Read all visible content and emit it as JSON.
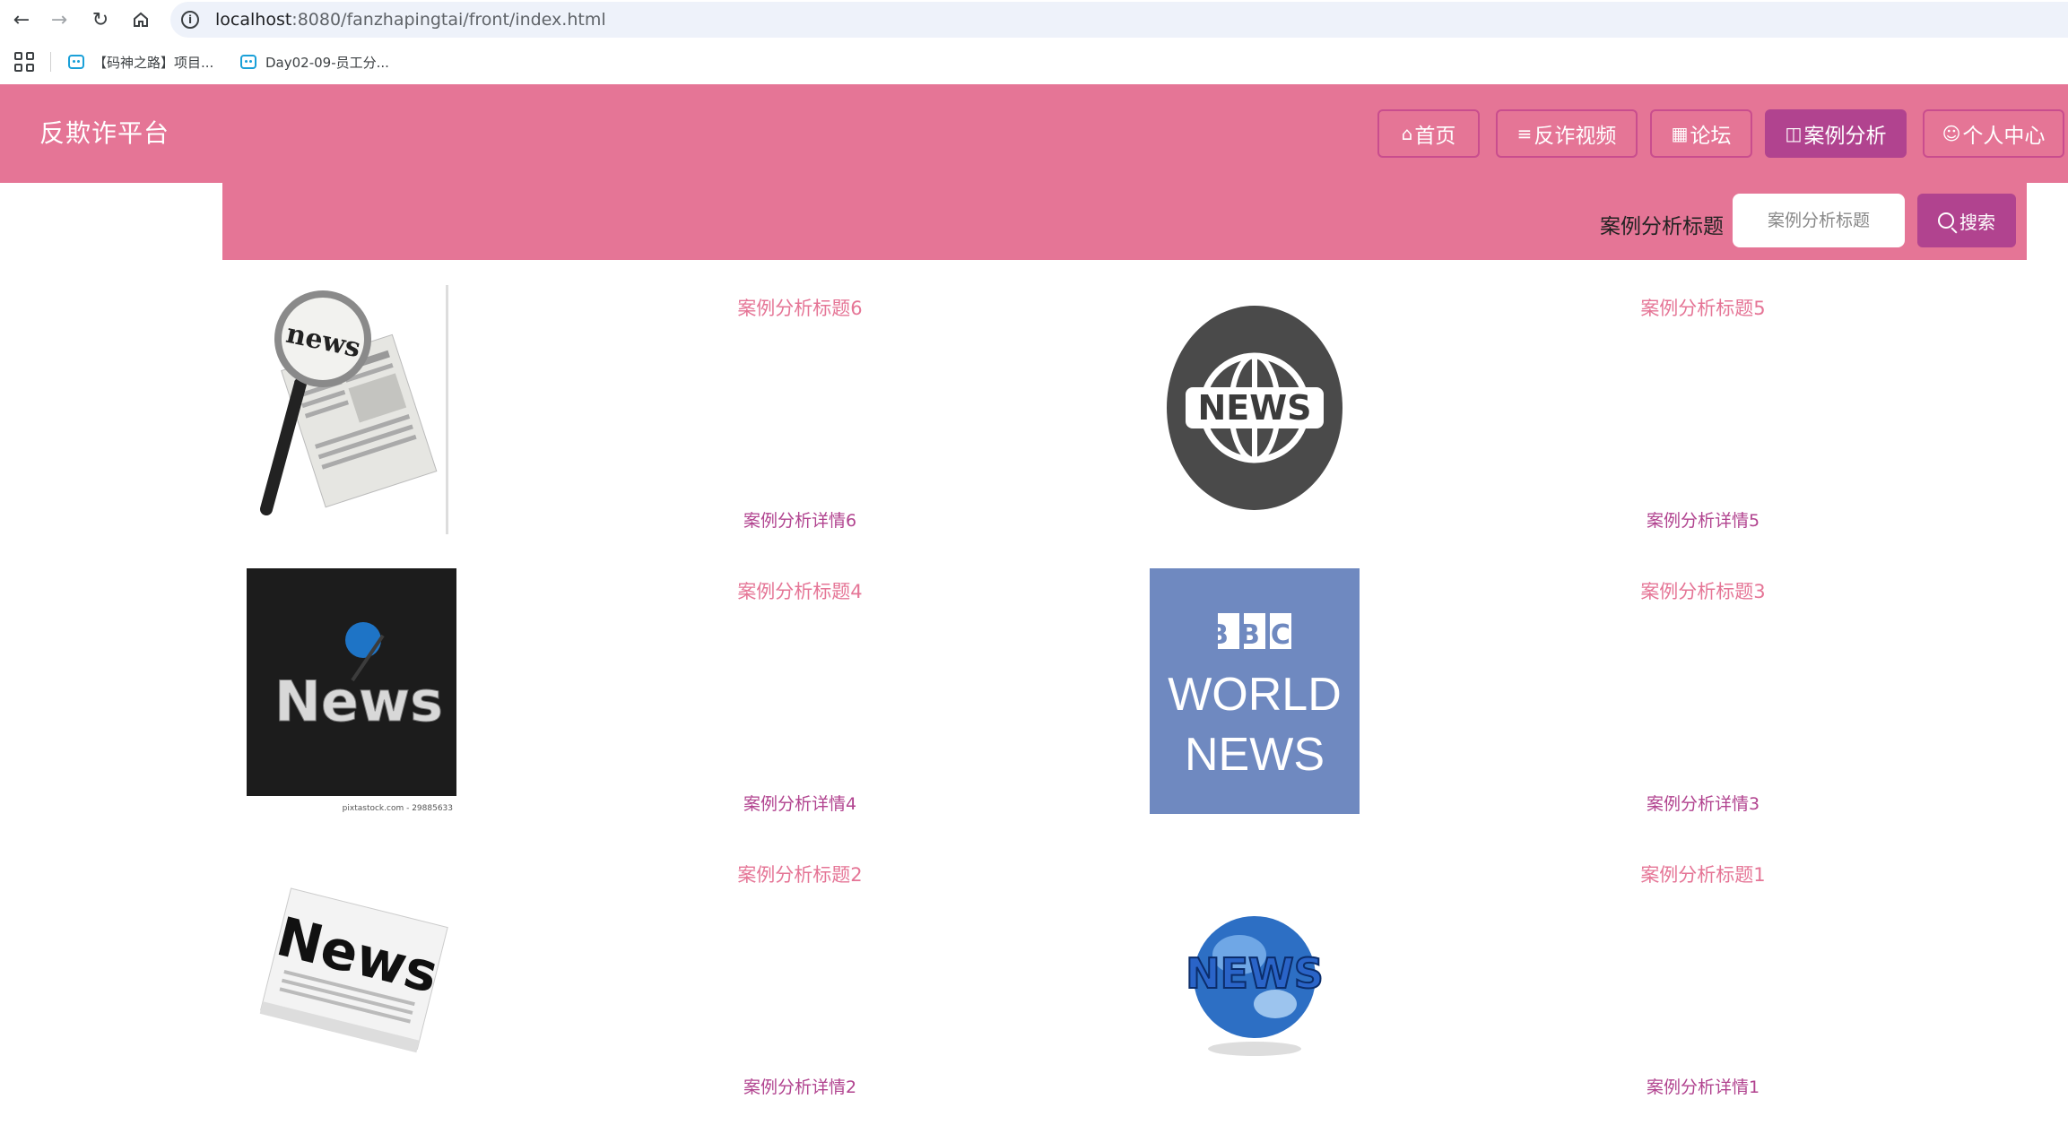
{
  "browser": {
    "url_host": "localhost",
    "url_path": ":8080/fanzhapingtai/front/index.html",
    "bookmarks": [
      {
        "label": "【码神之路】项目..."
      },
      {
        "label": "Day02-09-员工分..."
      }
    ]
  },
  "header": {
    "site_title": "反欺诈平台",
    "nav": [
      {
        "label": "首页",
        "icon": "home-icon"
      },
      {
        "label": "反诈视频",
        "icon": "sliders-icon"
      },
      {
        "label": "论坛",
        "icon": "calendar-icon"
      },
      {
        "label": "案例分析",
        "icon": "book-icon",
        "active": true
      },
      {
        "label": "个人中心",
        "icon": "user-icon"
      }
    ]
  },
  "search": {
    "label": "案例分析标题",
    "placeholder": "案例分析标题",
    "button_label": "搜索"
  },
  "cases": [
    {
      "title": "案例分析标题6",
      "detail": "案例分析详情6",
      "image": "magnifier-newspaper"
    },
    {
      "title": "案例分析标题5",
      "detail": "案例分析详情5",
      "image": "news-globe-badge"
    },
    {
      "title": "案例分析标题4",
      "detail": "案例分析详情4",
      "image": "dark-news-globe"
    },
    {
      "title": "案例分析标题3",
      "detail": "案例分析详情3",
      "image": "bbc-world-news"
    },
    {
      "title": "案例分析标题2",
      "detail": "案例分析详情2",
      "image": "newspaper-news"
    },
    {
      "title": "案例分析标题1",
      "detail": "案例分析详情1",
      "image": "blue-globe-news"
    }
  ],
  "image_text": {
    "news_lower": "news",
    "news_upper": "NEWS",
    "news_title": "News",
    "bbc": "BBC",
    "world": "WORLD",
    "news_word": "NEWS",
    "stock_credit": "pixtastock.com - 29885633"
  },
  "colors": {
    "header_bg": "#e57596",
    "accent": "#b1438f",
    "title_text": "#e57596",
    "detail_text": "#b1438f"
  }
}
